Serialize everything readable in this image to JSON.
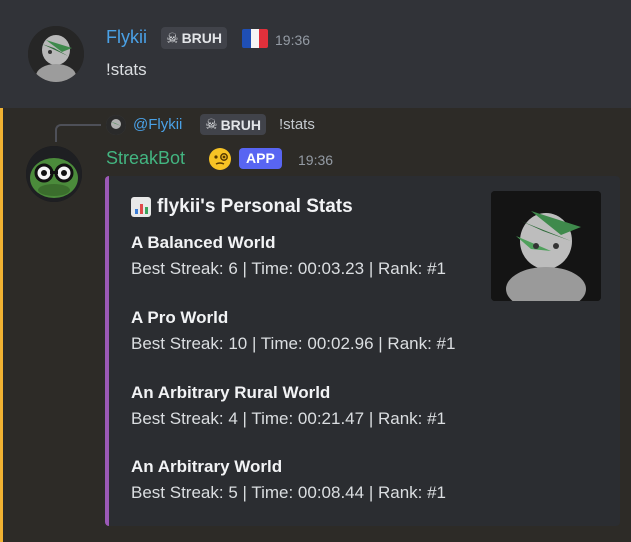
{
  "message1": {
    "author": "Flykii",
    "tag_label": "BRUH",
    "tag_icon": "skull-icon",
    "flag": "france-flag",
    "time": "19:36",
    "content": "!stats"
  },
  "reply": {
    "mention": "@Flykii",
    "tag_label": "BRUH",
    "content": "!stats"
  },
  "message2": {
    "author": "StreakBot",
    "emoji": "monocle-face-icon",
    "badge": "APP",
    "time": "19:36",
    "embed": {
      "accent_color": "#9b59b6",
      "title_icon": "bar-chart-icon",
      "title": "flykii's Personal Stats",
      "fields": [
        {
          "name": "A Balanced World",
          "value": "Best Streak: 6 | Time: 00:03.23 | Rank: #1"
        },
        {
          "name": "A Pro World",
          "value": "Best Streak: 10 | Time: 00:02.96 | Rank: #1"
        },
        {
          "name": "An Arbitrary Rural World",
          "value": "Best Streak: 4 | Time: 00:21.47 | Rank: #1"
        },
        {
          "name": "An Arbitrary World",
          "value": "Best Streak: 5 | Time: 00:08.44 | Rank: #1"
        }
      ]
    }
  },
  "colors": {
    "username_blue": "#4aa1e6",
    "bot_green": "#43b581",
    "app_badge": "#5865f2",
    "highlight_bar": "#f0b232"
  }
}
